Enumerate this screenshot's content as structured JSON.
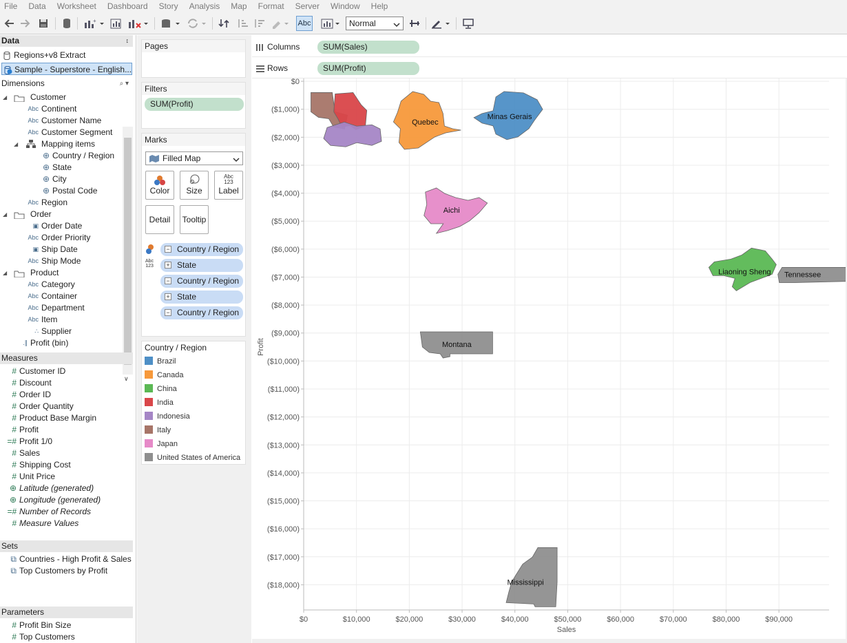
{
  "menu": [
    "File",
    "Data",
    "Worksheet",
    "Dashboard",
    "Story",
    "Analysis",
    "Map",
    "Format",
    "Server",
    "Window",
    "Help"
  ],
  "toolbar": {
    "abc_label": "Abc",
    "mark_size": "Normal"
  },
  "data_pane": {
    "title": "Data",
    "sources": [
      {
        "label": "Regions+v8 Extract",
        "selected": false
      },
      {
        "label": "Sample - Superstore - English...",
        "selected": true
      }
    ]
  },
  "dimensions": {
    "title": "Dimensions",
    "items": [
      {
        "label": "Customer",
        "type": "folder",
        "level": 0
      },
      {
        "label": "Continent",
        "type": "abc",
        "level": 1
      },
      {
        "label": "Customer Name",
        "type": "abc",
        "level": 1
      },
      {
        "label": "Customer Segment",
        "type": "abc",
        "level": 1
      },
      {
        "label": "Mapping items",
        "type": "hierarchy",
        "level": 1
      },
      {
        "label": "Country / Region",
        "type": "geo",
        "level": 2
      },
      {
        "label": "State",
        "type": "geo",
        "level": 2
      },
      {
        "label": "City",
        "type": "geo",
        "level": 2
      },
      {
        "label": "Postal Code",
        "type": "geo",
        "level": 2
      },
      {
        "label": "Region",
        "type": "abc",
        "level": 1
      },
      {
        "label": "Order",
        "type": "folder",
        "level": 0
      },
      {
        "label": "Order Date",
        "type": "date",
        "level": 1
      },
      {
        "label": "Order Priority",
        "type": "abc",
        "level": 1
      },
      {
        "label": "Ship Date",
        "type": "date",
        "level": 1
      },
      {
        "label": "Ship Mode",
        "type": "abc",
        "level": 1
      },
      {
        "label": "Product",
        "type": "folder",
        "level": 0
      },
      {
        "label": "Category",
        "type": "abc",
        "level": 1
      },
      {
        "label": "Container",
        "type": "abc",
        "level": 1
      },
      {
        "label": "Department",
        "type": "abc",
        "level": 1
      },
      {
        "label": "Item",
        "type": "abc",
        "level": 1
      },
      {
        "label": "Supplier",
        "type": "link",
        "level": 1
      },
      {
        "label": "Profit (bin)",
        "type": "bin",
        "level": 0
      }
    ]
  },
  "measures": {
    "title": "Measures",
    "items": [
      {
        "label": "Customer ID",
        "type": "num",
        "italic": false
      },
      {
        "label": "Discount",
        "type": "num",
        "italic": false
      },
      {
        "label": "Order ID",
        "type": "num",
        "italic": false
      },
      {
        "label": "Order Quantity",
        "type": "num",
        "italic": false
      },
      {
        "label": "Product Base Margin",
        "type": "num",
        "italic": false
      },
      {
        "label": "Profit",
        "type": "num",
        "italic": false
      },
      {
        "label": "Profit 1/0",
        "type": "calc",
        "italic": false
      },
      {
        "label": "Sales",
        "type": "num",
        "italic": false
      },
      {
        "label": "Shipping Cost",
        "type": "num",
        "italic": false
      },
      {
        "label": "Unit Price",
        "type": "num",
        "italic": false
      },
      {
        "label": "Latitude (generated)",
        "type": "geo",
        "italic": true
      },
      {
        "label": "Longitude (generated)",
        "type": "geo",
        "italic": true
      },
      {
        "label": "Number of Records",
        "type": "calc",
        "italic": true
      },
      {
        "label": "Measure Values",
        "type": "num",
        "italic": true
      }
    ]
  },
  "sets": {
    "title": "Sets",
    "items": [
      "Countries - High Profit & Sales",
      "Top Customers by Profit"
    ]
  },
  "parameters": {
    "title": "Parameters",
    "items": [
      "Profit Bin Size",
      "Top Customers"
    ]
  },
  "pages": {
    "title": "Pages"
  },
  "filters": {
    "title": "Filters",
    "pills": [
      "SUM(Profit)"
    ]
  },
  "marks": {
    "title": "Marks",
    "type": "Filled Map",
    "buttons": {
      "color": "Color",
      "size": "Size",
      "label": "Label",
      "detail": "Detail",
      "tooltip": "Tooltip"
    },
    "label_glyph": {
      "top": "Abc",
      "bottom": "123"
    },
    "pills": [
      "Country / Region",
      "State",
      "Country / Region",
      "State",
      "Country / Region"
    ]
  },
  "legend": {
    "title": "Country / Region",
    "items": [
      {
        "label": "Brazil",
        "color": "#4e8fc6"
      },
      {
        "label": "Canada",
        "color": "#f7993b"
      },
      {
        "label": "China",
        "color": "#5bb854"
      },
      {
        "label": "India",
        "color": "#d94649"
      },
      {
        "label": "Indonesia",
        "color": "#a586c6"
      },
      {
        "label": "Italy",
        "color": "#a77568"
      },
      {
        "label": "Japan",
        "color": "#e68ac8"
      },
      {
        "label": "United States of America",
        "color": "#8f8f8f"
      }
    ]
  },
  "columns_shelf": {
    "label": "Columns",
    "pill": "SUM(Sales)"
  },
  "rows_shelf": {
    "label": "Rows",
    "pill": "SUM(Profit)"
  },
  "chart_data": {
    "type": "filled-map-scatter",
    "xlabel": "Sales",
    "ylabel": "Profit",
    "x_ticks": [
      "$0",
      "$10,000",
      "$20,000",
      "$30,000",
      "$40,000",
      "$50,000",
      "$60,000",
      "$70,000",
      "$80,000",
      "$90,000"
    ],
    "y_ticks": [
      "$0",
      "($1,000)",
      "($2,000)",
      "($3,000)",
      "($4,000)",
      "($5,000)",
      "($6,000)",
      "($7,000)",
      "($8,000)",
      "($9,000)",
      "($10,000)",
      "($11,000)",
      "($12,000)",
      "($13,000)",
      "($14,000)",
      "($15,000)",
      "($16,000)",
      "($17,000)",
      "($18,000)"
    ],
    "xlim": [
      0,
      99500
    ],
    "ylim": [
      -18900,
      100
    ],
    "grid": true,
    "marks": [
      {
        "label": "",
        "country": "Italy",
        "x": 1500,
        "y": -600
      },
      {
        "label": "",
        "country": "India",
        "x": 7000,
        "y": -600
      },
      {
        "label": "",
        "country": "Indonesia",
        "x": 9000,
        "y": -1900
      },
      {
        "label": "Quebec",
        "country": "Canada",
        "x": 23000,
        "y": -1450
      },
      {
        "label": "Minas Gerais",
        "country": "Brazil",
        "x": 39000,
        "y": -1250
      },
      {
        "label": "Aichi",
        "country": "Japan",
        "x": 28000,
        "y": -4600
      },
      {
        "label": "Liaoning Sheng",
        "country": "China",
        "x": 83500,
        "y": -6800
      },
      {
        "label": "Tennessee",
        "country": "United States of America",
        "x": 94500,
        "y": -6900
      },
      {
        "label": "Montana",
        "country": "United States of America",
        "x": 29000,
        "y": -9400
      },
      {
        "label": "Mississippi",
        "country": "United States of America",
        "x": 42000,
        "y": -17900
      }
    ]
  }
}
